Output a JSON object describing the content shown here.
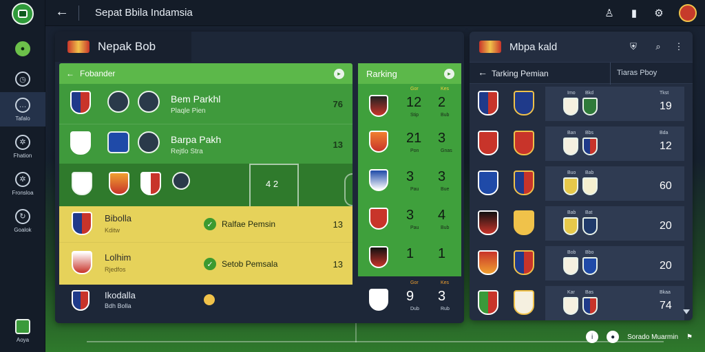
{
  "app": {
    "title": "Sepat Bbila Indamsia",
    "back_glyph": "←"
  },
  "sidebar": {
    "items": [
      {
        "label": "",
        "icon": "ball-icon"
      },
      {
        "label": "",
        "icon": "clock-icon"
      },
      {
        "label": "Tafalo",
        "icon": "chat-icon"
      },
      {
        "label": "Fhation",
        "icon": "gear-ball-icon"
      },
      {
        "label": "Fronsloa",
        "icon": "gear-ball-icon"
      },
      {
        "label": "Goalok",
        "icon": "refresh-icon"
      }
    ],
    "bottom_label": "Aoya"
  },
  "main": {
    "title": "Nepak Bob",
    "fixtures": {
      "title": "Fobander",
      "back_glyph": "←",
      "rows": [
        {
          "name": "Bem Parkhl",
          "sub": "Plaqle Pien",
          "score": "76"
        },
        {
          "name": "Barpa Pakh",
          "sub": "Rejtlo Stra",
          "score": "13"
        }
      ],
      "pitch_score": "4  2",
      "highlights": [
        {
          "name": "Bibolla",
          "sub": "Kditw",
          "label": "Ralfae Pemsin",
          "score": "13"
        },
        {
          "name": "Lolhim",
          "sub": "Rjedfos",
          "label": "Setob Pemsala",
          "score": "13"
        }
      ],
      "last": {
        "name": "Ikodalla",
        "sub": "Bdh Bolla"
      }
    },
    "ranking": {
      "title": "Rarking",
      "head_labels": [
        "Gor",
        "Kes"
      ],
      "rows": [
        {
          "a": "12",
          "b": "2",
          "sa": "Stip",
          "sb": "Bub"
        },
        {
          "a": "21",
          "b": "3",
          "sa": "Pon",
          "sb": "Gnas"
        },
        {
          "a": "3",
          "b": "3",
          "sa": "Pau",
          "sb": "Bue"
        },
        {
          "a": "3",
          "b": "4",
          "sa": "Pau",
          "sb": "Bub"
        },
        {
          "a": "1",
          "b": "1",
          "sa": "",
          "sb": ""
        },
        {
          "a": "9",
          "b": "3",
          "sa": "Dub",
          "sb": "Rub"
        }
      ]
    }
  },
  "right": {
    "title": "Mbpa kald",
    "sub_left": "Tarking Pemian",
    "sub_right": "Tiaras Pboy",
    "rows": [
      {
        "ma": "Imo",
        "mb": "Bkd",
        "sl": "Tkst",
        "score": "19"
      },
      {
        "ma": "Ban",
        "mb": "Bbs",
        "sl": "Bda",
        "score": "12"
      },
      {
        "ma": "Buo",
        "mb": "Bab",
        "sl": "",
        "score": "60"
      },
      {
        "ma": "Bab",
        "mb": "Bat",
        "sl": "",
        "score": "20"
      },
      {
        "ma": "Bob",
        "mb": "Bbo",
        "sl": "",
        "score": "20"
      },
      {
        "ma": "Kar",
        "mb": "Bas",
        "sl": "Bkaa",
        "score": "74"
      }
    ]
  },
  "footer": {
    "text": "Sorado Muarmin"
  },
  "colors": {
    "green": "#5cb84a",
    "yellow": "#e6d25a",
    "panel": "#1d2738"
  }
}
